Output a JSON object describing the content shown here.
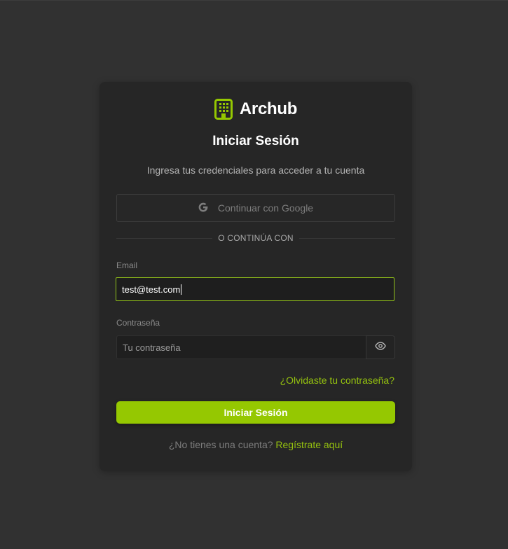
{
  "brand": {
    "name": "Archub",
    "icon": "building-icon",
    "accent_color": "#95c801"
  },
  "login": {
    "title": "Iniciar Sesión",
    "subtitle": "Ingresa tus credenciales para acceder a tu cuenta",
    "google_button": {
      "label": "Continuar con Google",
      "icon": "google-icon"
    },
    "divider_text": "O CONTINÚA CON",
    "email": {
      "label": "Email",
      "value": "test@test.com"
    },
    "password": {
      "label": "Contraseña",
      "placeholder": "Tu contraseña",
      "toggle_icon": "eye-icon"
    },
    "forgot_link": "¿Olvidaste tu contraseña?",
    "submit_label": "Iniciar Sesión",
    "signup_prompt": "¿No tienes una cuenta?",
    "signup_link": "Regístrate aquí"
  }
}
